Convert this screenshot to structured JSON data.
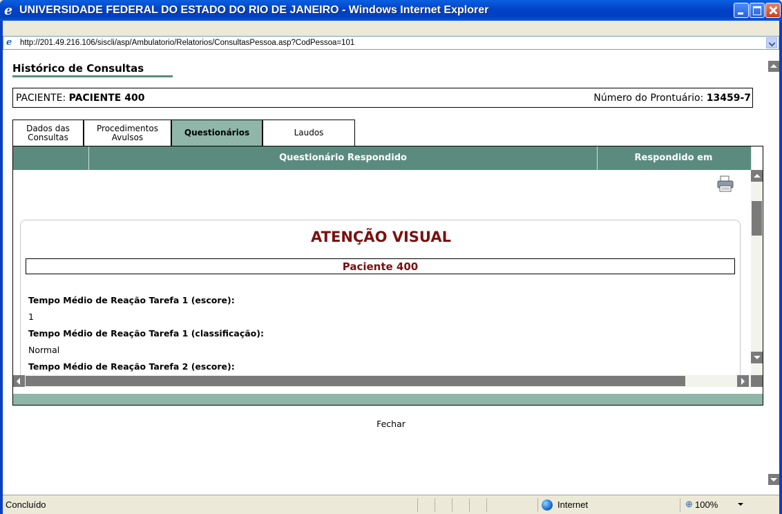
{
  "window": {
    "title": "UNIVERSIDADE FEDERAL DO ESTADO DO RIO DE JANEIRO - Windows Internet Explorer",
    "icon": "internet-explorer-icon"
  },
  "address_bar": {
    "url": "http://201.49.216.106/siscli/asp/Ambulatorio/Relatorios/ConsultasPessoa.asp?CodPessoa=101"
  },
  "page": {
    "title": "Histórico de Consultas",
    "patient_label": "PACIENTE:",
    "patient_name": "PACIENTE 400",
    "record_label": "Número do Prontuário:",
    "record_number": "13459-7"
  },
  "tabs": [
    {
      "label_line1": "Dados das",
      "label_line2": "Consultas",
      "active": false
    },
    {
      "label_line1": "Procedimentos",
      "label_line2": "Avulsos",
      "active": false
    },
    {
      "label_line1": "Questionários",
      "label_line2": "",
      "active": true
    },
    {
      "label_line1": "Laudos",
      "label_line2": "",
      "active": false
    }
  ],
  "table": {
    "col1_header": "",
    "col2_header": "Questionário Respondido",
    "col3_header": "Respondido em"
  },
  "questionnaire": {
    "title": "ATENÇÃO VISUAL",
    "patient": "Paciente 400",
    "items": [
      {
        "label": "Tempo Médio de Reação Tarefa 1 (escore):",
        "value": "1"
      },
      {
        "label": "Tempo Médio de Reação Tarefa 1 (classificação):",
        "value": "Normal"
      },
      {
        "label": "Tempo Médio de Reação Tarefa 2 (escore):",
        "value": ""
      }
    ]
  },
  "footer": {
    "close_label": "Fechar"
  },
  "status_bar": {
    "status": "Concluído",
    "zone": "Internet",
    "zoom": "100%"
  },
  "colors": {
    "header_green": "#5b8b7f",
    "active_tab": "#8fb6a8",
    "title_red": "#7a1010"
  }
}
